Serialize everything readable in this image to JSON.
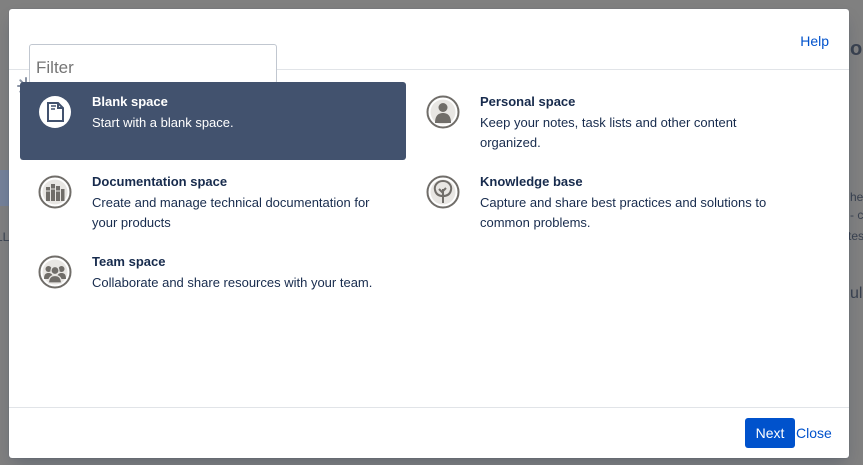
{
  "background_fragments": {
    "top_right": "or",
    "mid_right_1": "he",
    "mid_right_2": "- c",
    "mid_right_3": "tes",
    "lower_right": "ul",
    "left_edge": "LL"
  },
  "header": {
    "filter_placeholder": "Filter",
    "help_label": "Help"
  },
  "blueprints": [
    {
      "title": "Blank space",
      "description": "Start with a blank space.",
      "icon": "blank-page-icon",
      "selected": true
    },
    {
      "title": "Personal space",
      "description": "Keep your notes, task lists and other content organized.",
      "icon": "person-icon",
      "selected": false
    },
    {
      "title": "Documentation space",
      "description": "Create and manage technical documentation for your products",
      "icon": "books-icon",
      "selected": false
    },
    {
      "title": "Knowledge base",
      "description": "Capture and share best practices and solutions to common problems.",
      "icon": "tree-icon",
      "selected": false
    },
    {
      "title": "Team space",
      "description": "Collaborate and share resources with your team.",
      "icon": "team-icon",
      "selected": false
    }
  ],
  "footer": {
    "next_label": "Next",
    "close_label": "Close"
  },
  "colors": {
    "selected_bg": "#42526e",
    "primary": "#0052cc",
    "icon_gray": "#706d69"
  }
}
